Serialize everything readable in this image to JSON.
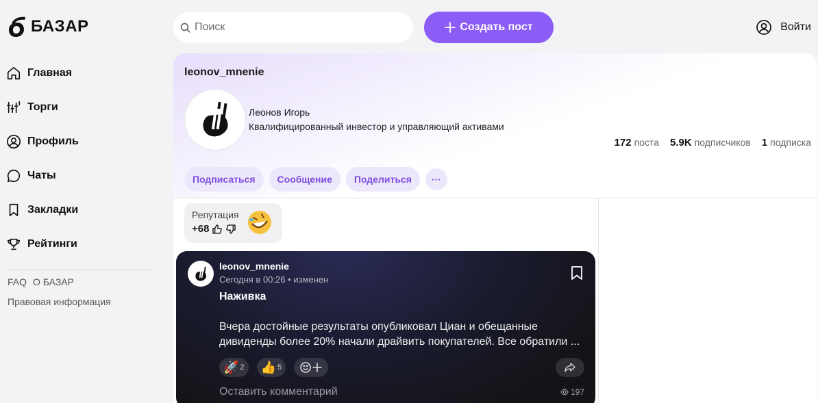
{
  "brand": {
    "name": "БАЗАР"
  },
  "nav": {
    "items": [
      {
        "label": "Главная",
        "icon": "home-icon"
      },
      {
        "label": "Торги",
        "icon": "trades-icon"
      },
      {
        "label": "Профиль",
        "icon": "profile-icon"
      },
      {
        "label": "Чаты",
        "icon": "chat-icon"
      },
      {
        "label": "Закладки",
        "icon": "bookmark-icon"
      },
      {
        "label": "Рейтинги",
        "icon": "trophy-icon"
      }
    ],
    "footer": {
      "faq": "FAQ",
      "about": "О БАЗАР",
      "legal": "Правовая информация"
    }
  },
  "header": {
    "search_placeholder": "Поиск",
    "create_label": "Создать пост",
    "login_label": "Войти",
    "accent": "#8b5cf6"
  },
  "profile": {
    "username": "leonov_mnenie",
    "fullname": "Леонов Игорь",
    "bio": "Квалифицированный инвестор и управляющий активами",
    "stats": {
      "posts_count": "172",
      "posts_label": "поста",
      "subscribers_count": "5.9K",
      "subscribers_label": "подписчиков",
      "subscriptions_count": "1",
      "subscriptions_label": "подписка"
    },
    "actions": {
      "subscribe": "Подписаться",
      "message": "Сообщение",
      "share": "Поделиться",
      "more": "···"
    }
  },
  "reputation": {
    "label": "Репутация",
    "value": "+68",
    "emoji": "🤣"
  },
  "post": {
    "author": "leonov_mnenie",
    "time": "Сегодня в 00:26 • изменен",
    "title": "Наживка",
    "text": "Вчера достойные результаты опубликовал Циан и обещанные дивиденды более 20% начали драйвить покупателей. Все обратили ...",
    "reactions": [
      {
        "emoji": "🚀",
        "count": "2"
      },
      {
        "emoji": "👍",
        "count": "5"
      }
    ],
    "comment_placeholder": "Оставить комментарий",
    "views": "197"
  }
}
